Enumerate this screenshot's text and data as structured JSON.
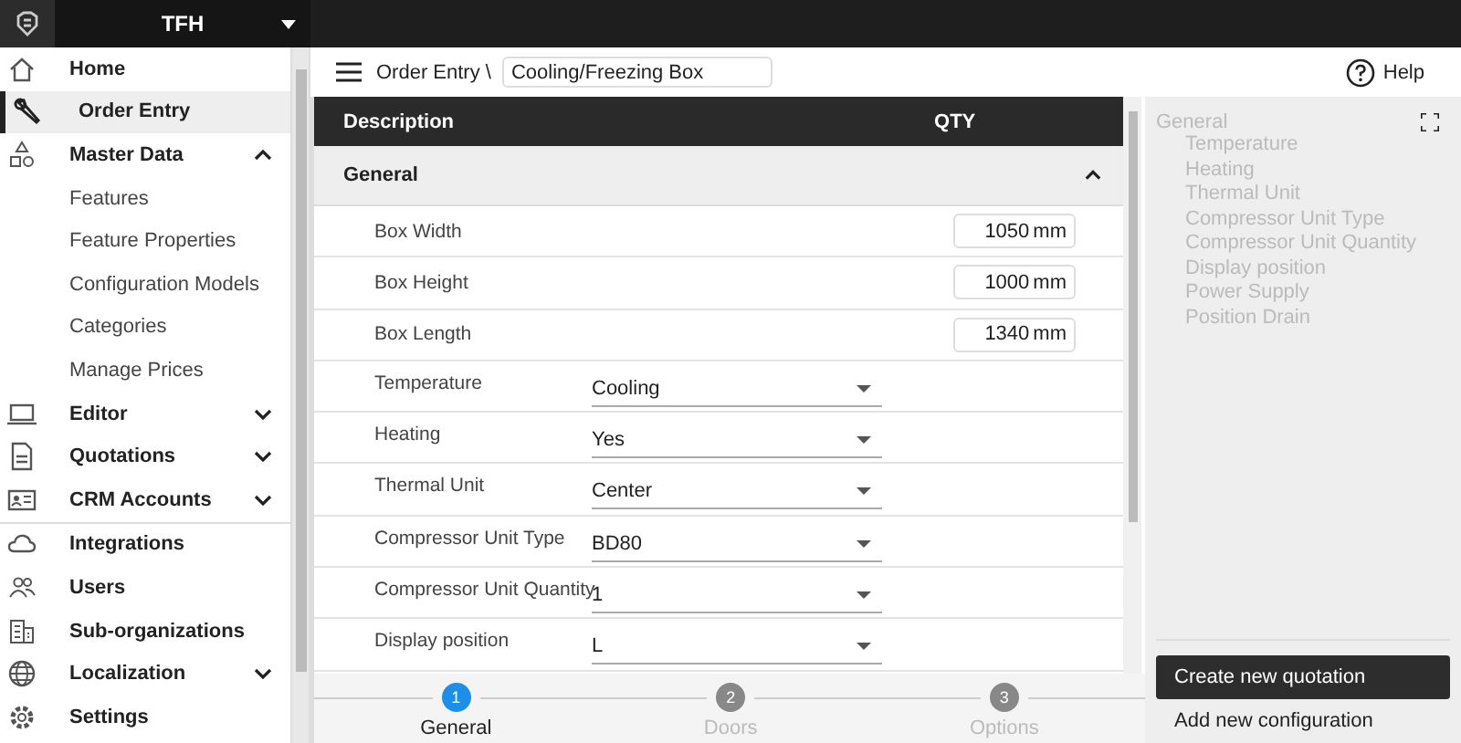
{
  "topbar": {
    "org": "TFH"
  },
  "sidebar": {
    "items": [
      {
        "label": "Home",
        "selected": false
      },
      {
        "label": "Order Entry",
        "selected": true
      },
      {
        "label": "Master Data",
        "selected": false,
        "expanded": true,
        "children": [
          {
            "label": "Features"
          },
          {
            "label": "Feature Properties"
          },
          {
            "label": "Configuration Models"
          },
          {
            "label": "Categories"
          },
          {
            "label": "Manage Prices"
          }
        ]
      },
      {
        "label": "Editor",
        "selected": false,
        "expanded": false
      },
      {
        "label": "Quotations",
        "selected": false,
        "expanded": false
      },
      {
        "label": "CRM Accounts",
        "selected": false,
        "expanded": false
      },
      {
        "label": "Integrations",
        "selected": false
      },
      {
        "label": "Users",
        "selected": false
      },
      {
        "label": "Sub-organizations",
        "selected": false
      },
      {
        "label": "Localization",
        "selected": false,
        "expanded": false
      },
      {
        "label": "Settings",
        "selected": false
      }
    ]
  },
  "breadcrumb": {
    "section": "Order Entry \\",
    "name": "Cooling/Freezing Box"
  },
  "help": "Help",
  "table": {
    "columns": [
      "Description",
      "QTY"
    ],
    "group": {
      "label": "General",
      "expanded": true
    },
    "rows": [
      {
        "kind": "number",
        "label": "Box Width",
        "value": "1050",
        "unit": "mm"
      },
      {
        "kind": "number",
        "label": "Box Height",
        "value": "1000",
        "unit": "mm"
      },
      {
        "kind": "number",
        "label": "Box Length",
        "value": "1340",
        "unit": "mm"
      },
      {
        "kind": "select",
        "label": "Temperature",
        "value": "Cooling"
      },
      {
        "kind": "select",
        "label": "Heating",
        "value": "Yes"
      },
      {
        "kind": "select",
        "label": "Thermal Unit",
        "value": "Center"
      },
      {
        "kind": "select",
        "label": "Compressor Unit Type",
        "value": "BD80"
      },
      {
        "kind": "select",
        "label": "Compressor Unit Quantity",
        "value": "1"
      },
      {
        "kind": "select",
        "label": "Display position",
        "value": "L"
      }
    ]
  },
  "steps": [
    {
      "number": "1",
      "label": "General",
      "selected": true
    },
    {
      "number": "2",
      "label": "Doors",
      "selected": false
    },
    {
      "number": "3",
      "label": "Options",
      "selected": false
    }
  ],
  "outline": {
    "title": "General",
    "items": [
      "Temperature",
      "Heating",
      "Thermal Unit",
      "Compressor Unit Type",
      "Compressor Unit Quantity",
      "Display position",
      "Power Supply",
      "Position Drain"
    ]
  },
  "actions": [
    {
      "kind": "primary",
      "label": "Create new quotation"
    },
    {
      "kind": "plain",
      "label": "Add new configuration"
    }
  ]
}
